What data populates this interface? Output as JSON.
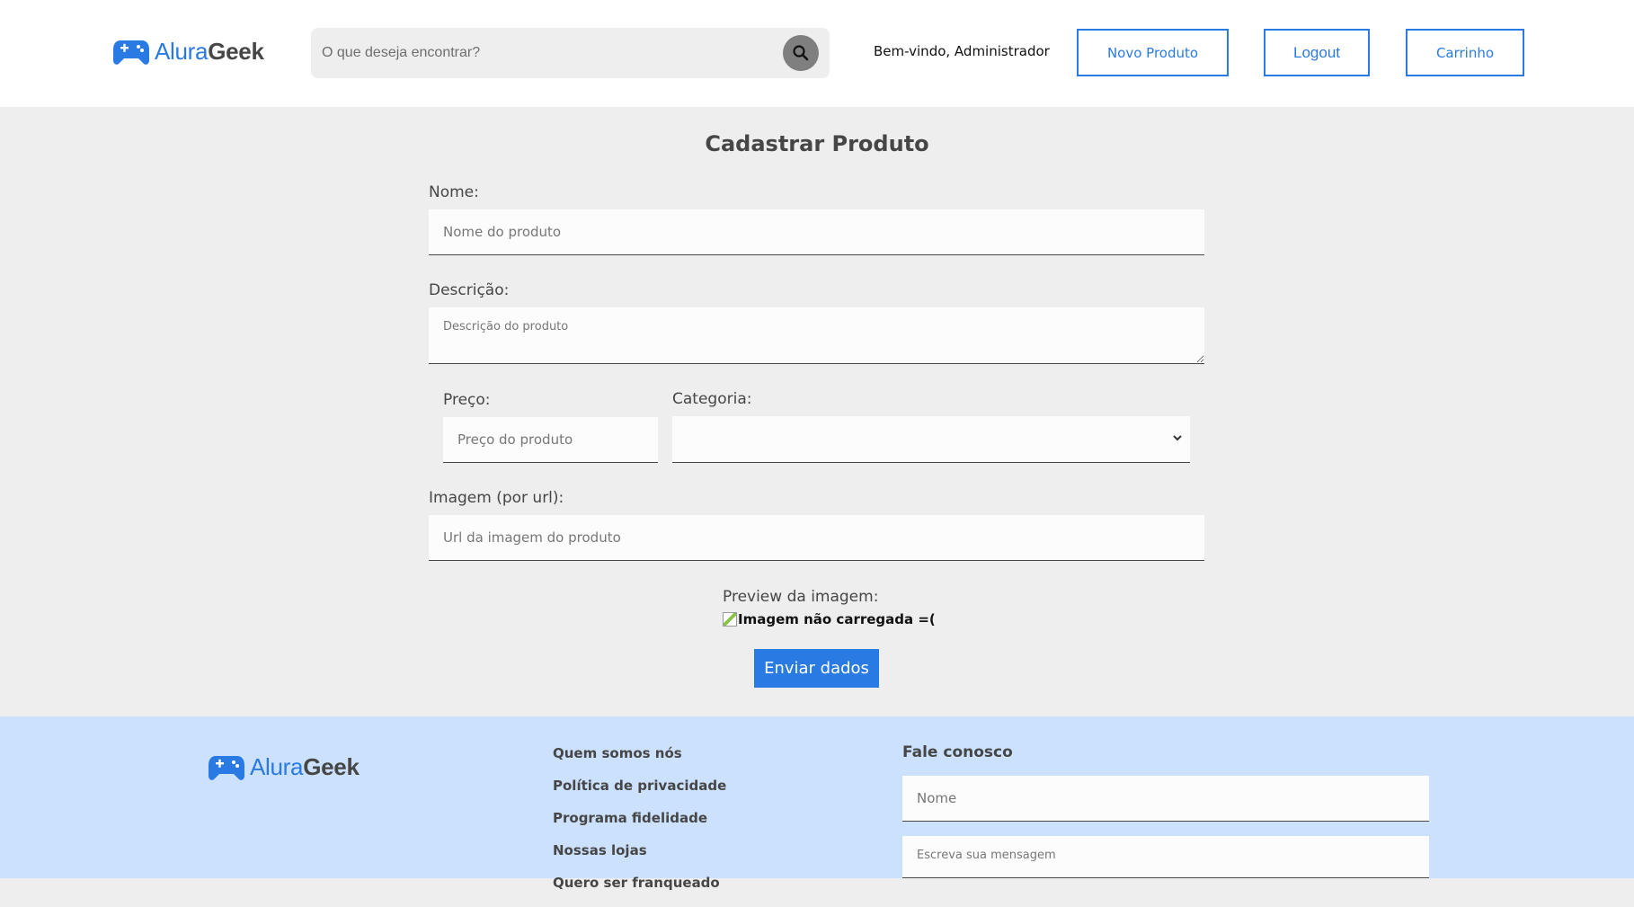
{
  "brand": {
    "logo_part1": "Alura",
    "logo_part2": "Geek",
    "logo_icon": "gamepad-icon",
    "accent": "#2a7ae4",
    "text_dark": "#464646"
  },
  "header": {
    "search_placeholder": "O que deseja encontrar?",
    "search_icon": "search-icon",
    "welcome": "Bem-vindo, Administrador",
    "buttons": {
      "new_product": "Novo Produto",
      "logout": "Logout",
      "cart": "Carrinho"
    }
  },
  "form": {
    "title": "Cadastrar Produto",
    "name_label": "Nome:",
    "name_placeholder": "Nome do produto",
    "description_label": "Descrição:",
    "description_placeholder": "Descrição do produto",
    "price_label": "Preço:",
    "price_placeholder": "Preço do produto",
    "category_label": "Categoria:",
    "category_selected": "",
    "image_label": "Imagem (por url):",
    "image_placeholder": "Url da imagem do produto",
    "preview_label": "Preview da imagem:",
    "preview_alt": "Imagem não carregada =(",
    "submit_label": "Enviar dados"
  },
  "footer": {
    "links": [
      "Quem somos nós",
      "Política de privacidade",
      "Programa fidelidade",
      "Nossas lojas",
      "Quero ser franqueado"
    ],
    "contact_title": "Fale conosco",
    "contact_name_placeholder": "Nome",
    "contact_message_placeholder": "Escreva sua mensagem"
  }
}
